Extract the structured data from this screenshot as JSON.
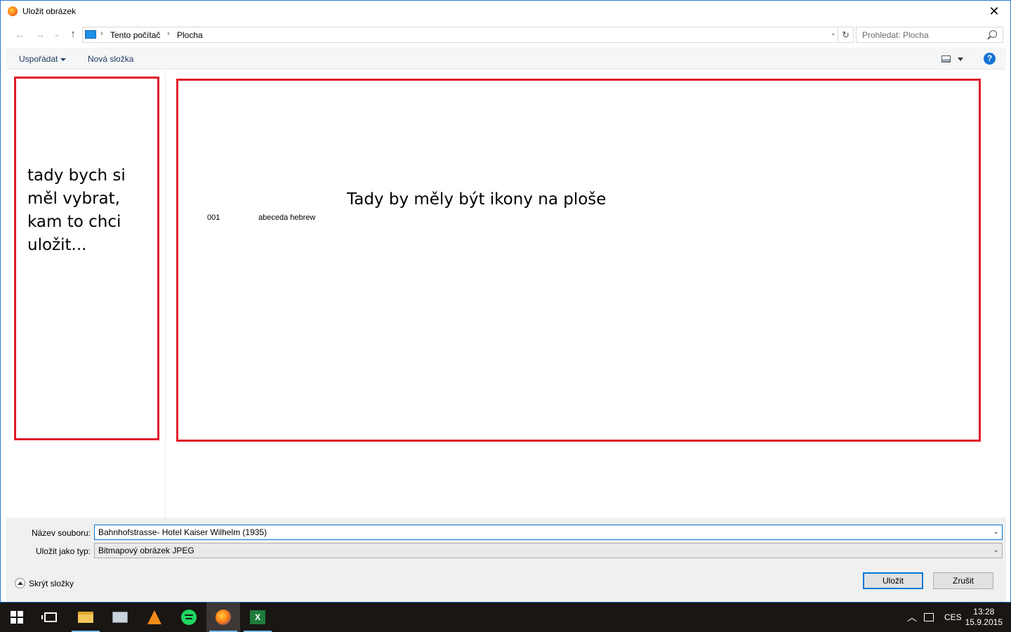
{
  "window": {
    "title": "Uložit obrázek",
    "close_glyph": "✕"
  },
  "nav": {
    "back_glyph": "←",
    "forward_glyph": "→",
    "recent_glyph": "⌄",
    "up_glyph": "↑",
    "breadcrumb": [
      "Tento počítač",
      "Plocha"
    ],
    "refresh_glyph": "↻",
    "search_placeholder": "Prohledat: Plocha"
  },
  "toolbar": {
    "organize_label": "Uspořádat",
    "new_folder_label": "Nová složka",
    "help_glyph": "?"
  },
  "annotations": {
    "left": "tady bych si měl vybrat, kam to chci uložit...",
    "main": "Tady by měly být ikony na ploše",
    "color": "#e01b2a"
  },
  "files": [
    {
      "name": "001"
    },
    {
      "name": "abeceda hebrew"
    }
  ],
  "form": {
    "filename_label": "Název souboru:",
    "filename_value": "Bahnhofstrasse- Hotel Kaiser Wilhelm (1935)",
    "filetype_label": "Uložit jako typ:",
    "filetype_value": "Bitmapový obrázek JPEG",
    "hide_folders_label": "Skrýt složky",
    "save_label": "Uložit",
    "cancel_label": "Zrušit"
  },
  "taskbar": {
    "apps": [
      "start-icon",
      "task-view-icon",
      "file-explorer-icon",
      "photos-icon",
      "vlc-icon",
      "spotify-icon",
      "firefox-icon",
      "excel-icon"
    ],
    "language": "CES",
    "time": "13:28",
    "date": "15.9.2015"
  },
  "colors": {
    "accent": "#0078d7",
    "annotation": "#e01b2a",
    "taskbar": "#1a1614"
  }
}
